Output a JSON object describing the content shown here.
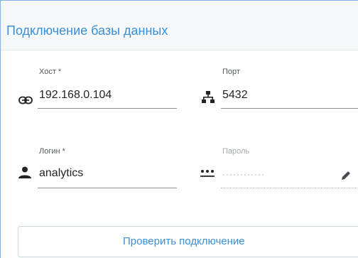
{
  "form": {
    "title": "Подключение базы данных",
    "host": {
      "label": "Хост *",
      "value": "192.168.0.104",
      "icon": "link-icon"
    },
    "port": {
      "label": "Порт",
      "value": "5432",
      "icon": "network-icon"
    },
    "login": {
      "label": "Логин *",
      "value": "analytics",
      "icon": "person-icon"
    },
    "password": {
      "label": "Пароль",
      "masked_value": "············",
      "icon": "password-icon",
      "edit_icon": "pencil-icon"
    },
    "check_button_label": "Проверить подключение"
  },
  "colors": {
    "accent": "#3b8fd6",
    "border": "#7fb2e2",
    "text": "#222426",
    "muted": "#a7abb0"
  }
}
